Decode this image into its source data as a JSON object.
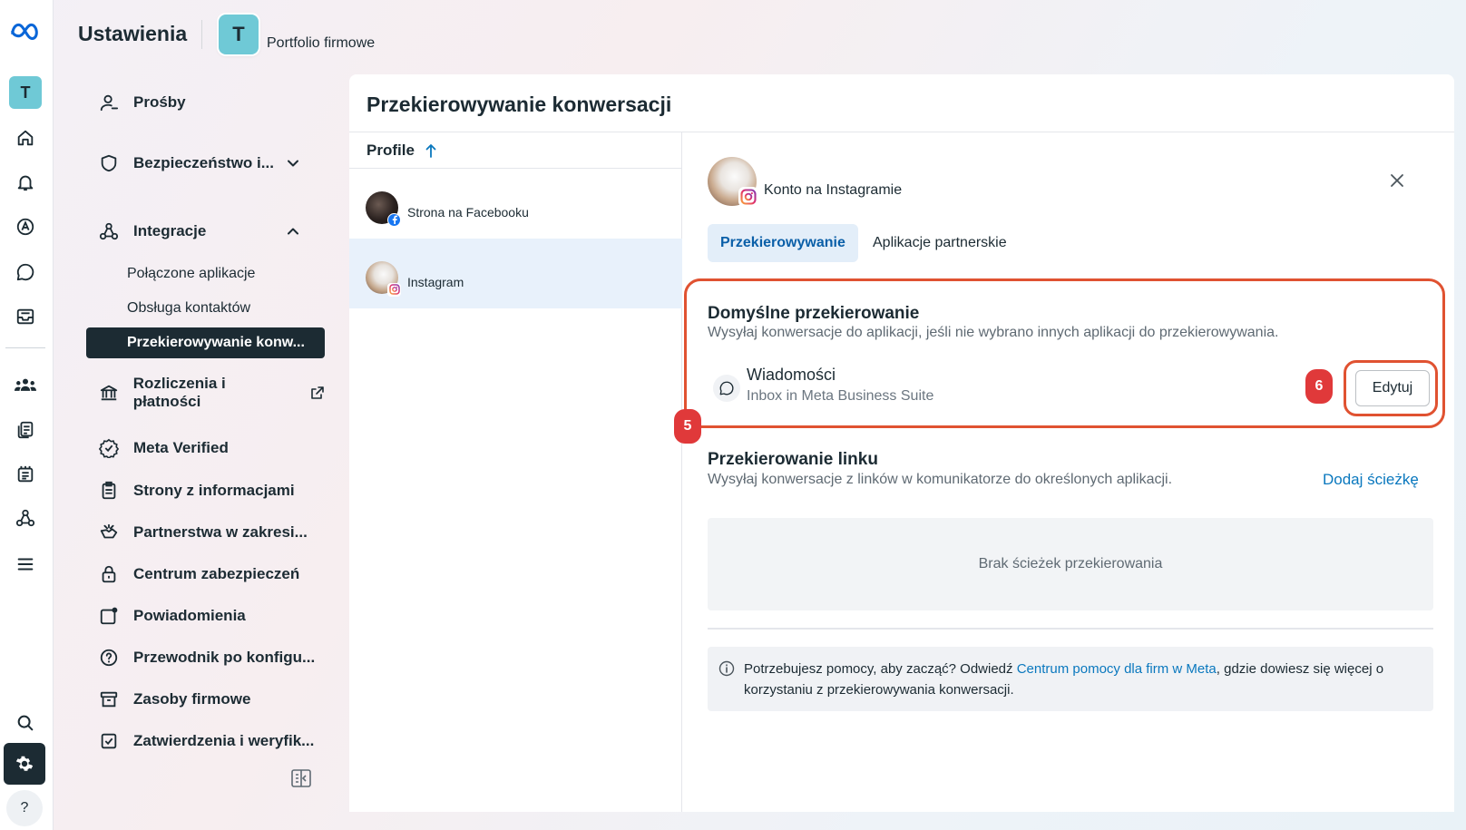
{
  "header": {
    "app_title": "Ustawienia",
    "portfolio_initial": "T",
    "portfolio_name": "Portfolio firmowe"
  },
  "rail": {
    "avatar_initial": "T",
    "icons": [
      "meta-logo-icon",
      "home-icon",
      "bell-icon",
      "ads-icon",
      "chat-icon",
      "inbox-icon",
      "people-icon",
      "pages-icon",
      "catalog-icon",
      "network-icon",
      "menu-icon",
      "search-icon",
      "gear-icon",
      "help-icon"
    ],
    "help_label": "?"
  },
  "sidebar": {
    "items": [
      {
        "label": "Prośby"
      },
      {
        "label": "Bezpieczeństwo i..."
      },
      {
        "label": "Integracje"
      },
      {
        "label": "Połączone aplikacje"
      },
      {
        "label": "Obsługa kontaktów"
      },
      {
        "label": "Przekierowywanie konw..."
      },
      {
        "label": "Rozliczenia i płatności"
      },
      {
        "label": "Meta Verified"
      },
      {
        "label": "Strony z informacjami"
      },
      {
        "label": "Partnerstwa w zakresi..."
      },
      {
        "label": "Centrum zabezpieczeń"
      },
      {
        "label": "Powiadomienia"
      },
      {
        "label": "Przewodnik po konfigu..."
      },
      {
        "label": "Zasoby firmowe"
      },
      {
        "label": "Zatwierdzenia i weryfik..."
      }
    ]
  },
  "main": {
    "title": "Przekierowywanie konwersacji",
    "list_header": "Profile",
    "profiles": [
      {
        "label": "Strona na Facebooku"
      },
      {
        "label": "Instagram"
      }
    ]
  },
  "detail": {
    "account_name": "Konto na Instagramie",
    "tabs": [
      {
        "label": "Przekierowywanie"
      },
      {
        "label": "Aplikacje partnerskie"
      }
    ],
    "default_routing": {
      "title": "Domyślne przekierowanie",
      "description": "Wysyłaj konwersacje do aplikacji, jeśli nie wybrano innych aplikacji do przekierowywania.",
      "app_title": "Wiadomości",
      "app_subtitle": "Inbox in Meta Business Suite",
      "edit_label": "Edytuj"
    },
    "link_routing": {
      "title": "Przekierowanie linku",
      "description": "Wysyłaj konwersacje z linków w komunikatorze do określonych aplikacji.",
      "add_label": "Dodaj ścieżkę",
      "empty_label": "Brak ścieżek przekierowania"
    },
    "help": {
      "text_before": "Potrzebujesz pomocy, aby zacząć? Odwiedź ",
      "link": "Centrum pomocy dla firm w Meta",
      "text_after": ", gdzie dowiesz się więcej o korzystaniu z przekierowywania konwersacji."
    },
    "annotations": {
      "step_box": "5",
      "step_button": "6"
    }
  },
  "colors": {
    "accent": "#0a78be",
    "annotation": "#e05231",
    "selected_row": "#e8f1fb",
    "dark_nav": "#1c2b33"
  }
}
